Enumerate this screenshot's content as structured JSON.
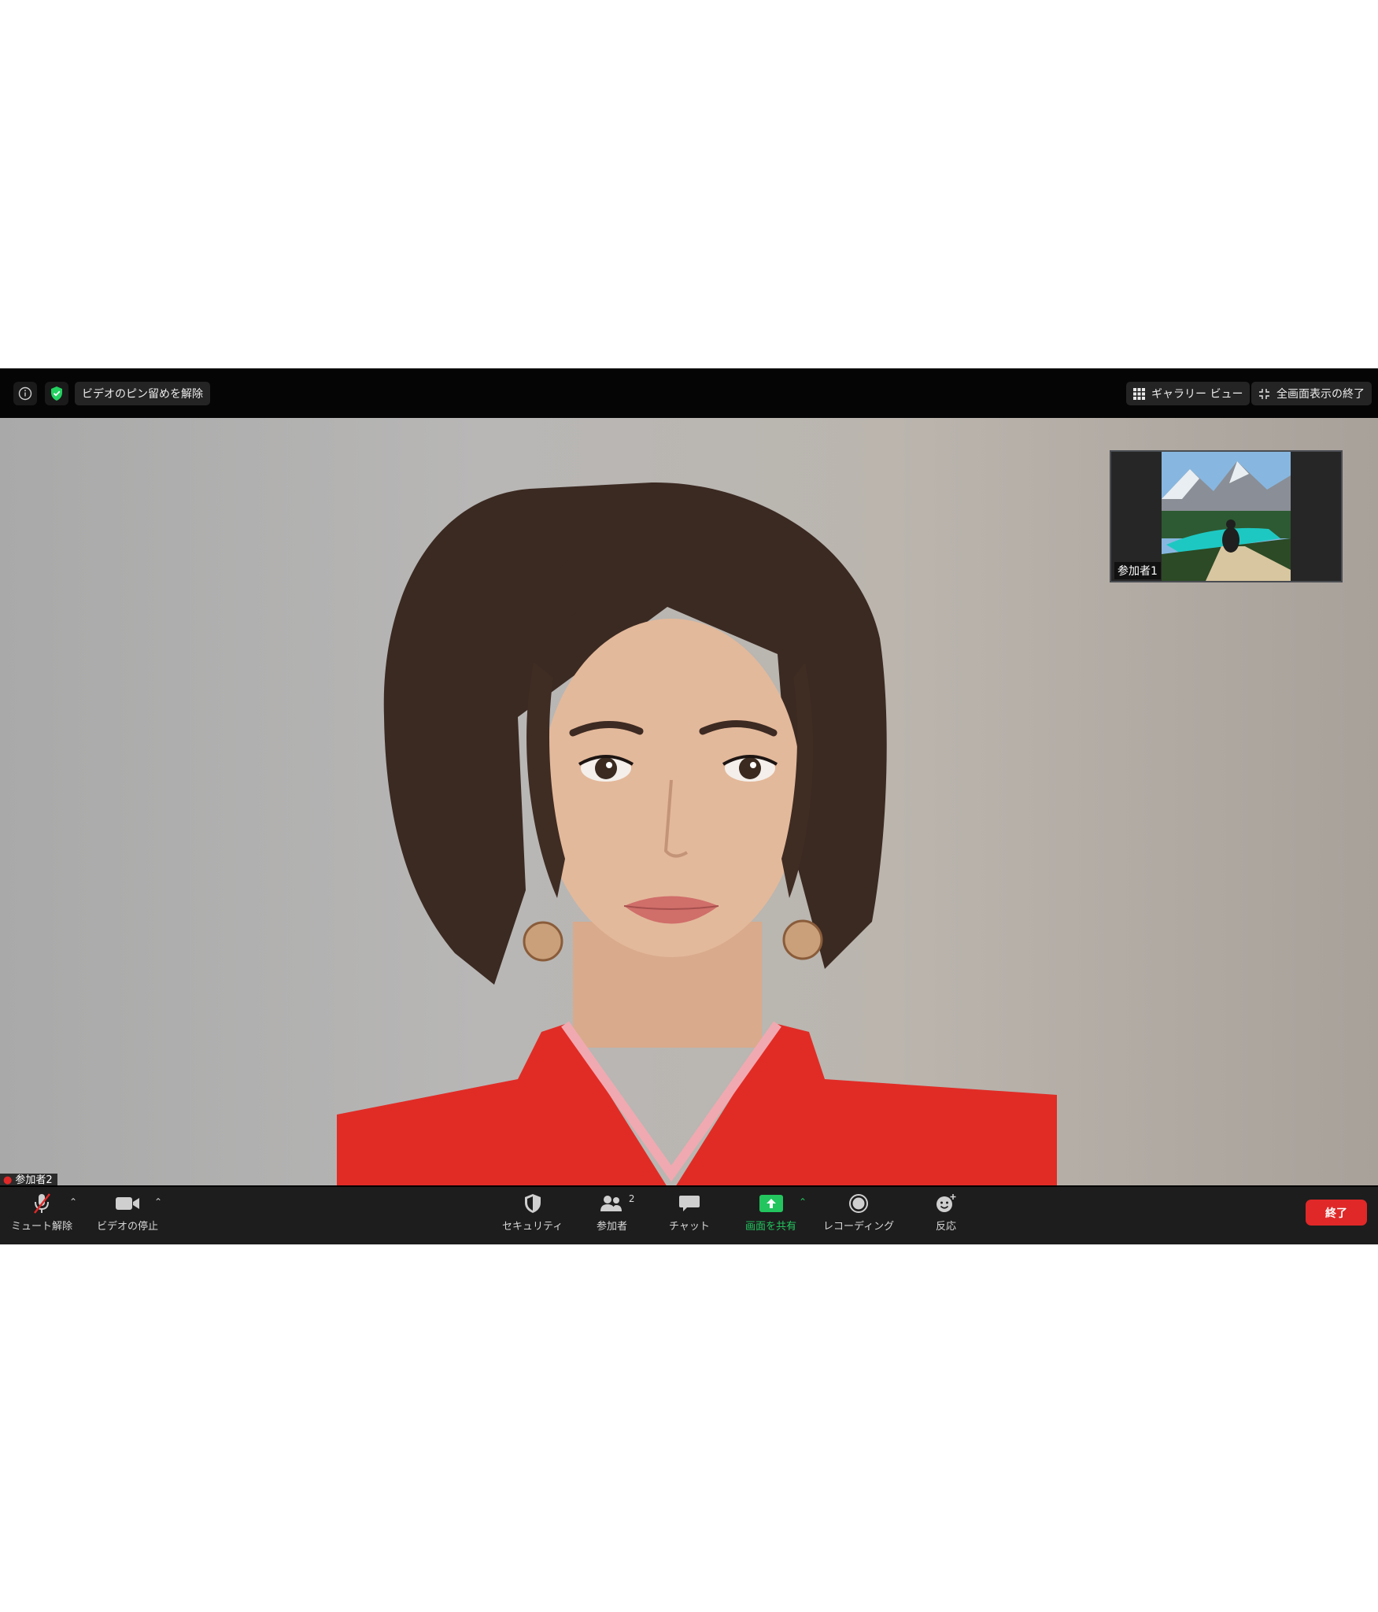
{
  "topbar": {
    "unpin_label": "ビデオのピン留めを解除",
    "gallery_label": "ギャラリー ビュー",
    "exit_fullscreen_label": "全画面表示の終了"
  },
  "thumbnail": {
    "label": "参加者1"
  },
  "self_view": {
    "label": "参加者2"
  },
  "toolbar": {
    "unmute_label": "ミュート解除",
    "video_label": "ビデオの停止",
    "security_label": "セキュリティ",
    "participants_label": "参加者",
    "participants_count": "2",
    "chat_label": "チャット",
    "share_label": "画面を共有",
    "record_label": "レコーディング",
    "reactions_label": "反応",
    "end_label": "終了"
  },
  "colors": {
    "share_green": "#22c55e",
    "end_red": "#e02828",
    "shield_green": "#23d160"
  }
}
